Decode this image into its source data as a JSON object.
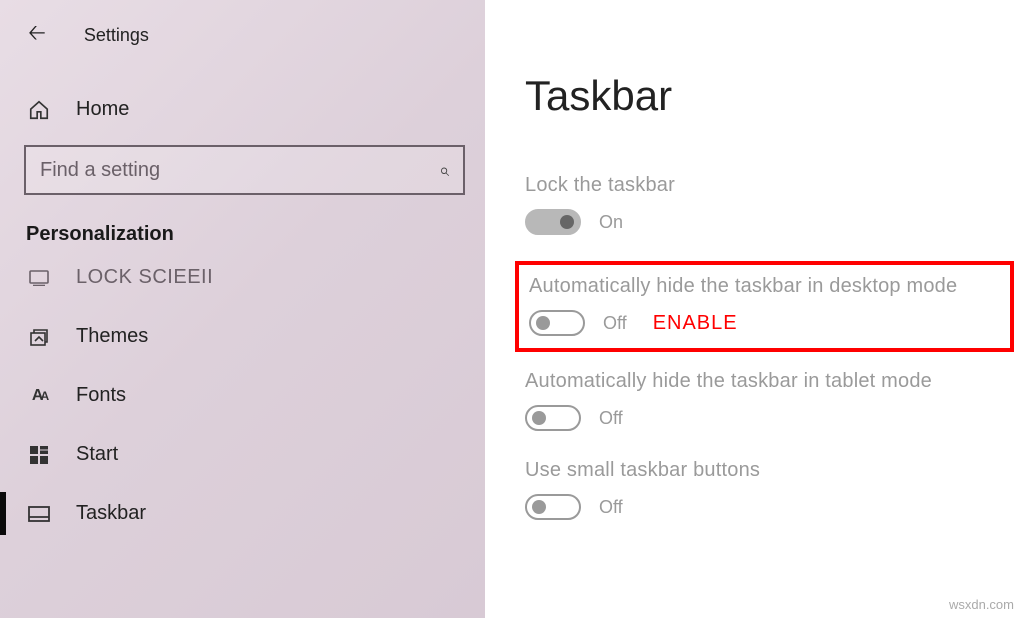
{
  "header": {
    "settings_label": "Settings"
  },
  "home": {
    "label": "Home"
  },
  "search": {
    "placeholder": "Find a setting"
  },
  "section": {
    "title": "Personalization"
  },
  "nav": {
    "lock_screen": "LOCK SCIEEII",
    "themes": "Themes",
    "fonts": "Fonts",
    "start": "Start",
    "taskbar": "Taskbar"
  },
  "page": {
    "title": "Taskbar"
  },
  "settings": {
    "lock": {
      "label": "Lock the taskbar",
      "state": "On"
    },
    "hide_desktop": {
      "label": "Automatically hide the taskbar in desktop mode",
      "state": "Off",
      "annotation": "ENABLE"
    },
    "hide_tablet": {
      "label": "Automatically hide the taskbar in tablet mode",
      "state": "Off"
    },
    "small_buttons": {
      "label": "Use small taskbar buttons",
      "state": "Off"
    }
  },
  "watermark": "wsxdn.com"
}
